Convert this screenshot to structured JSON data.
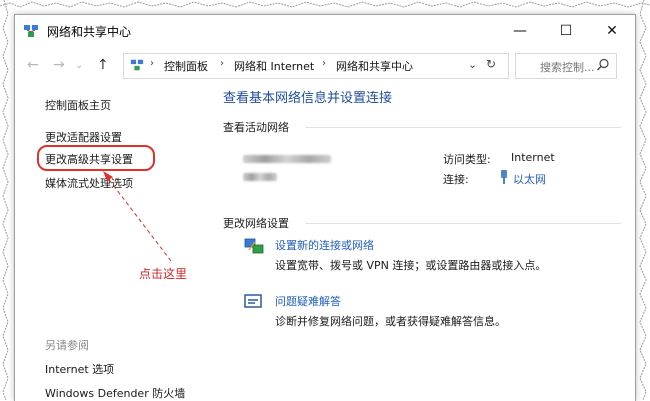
{
  "window": {
    "title": "网络和共享中心",
    "controls": {
      "minimize": "—",
      "maximize": "☐",
      "close": "✕"
    }
  },
  "address_bar": {
    "crumbs": [
      "控制面板",
      "网络和 Internet",
      "网络和共享中心"
    ],
    "search_placeholder": "搜索控制..."
  },
  "sidebar": {
    "home": "控制面板主页",
    "links": [
      "更改适配器设置",
      "更改高级共享设置",
      "媒体流式处理选项"
    ],
    "see_also_header": "另请参阅",
    "see_also": [
      "Internet 选项",
      "Windows Defender 防火墙"
    ]
  },
  "annotation": {
    "text": "点击这里",
    "color": "#d02828"
  },
  "main": {
    "title": "查看基本网络信息并设置连接",
    "active_networks_header": "查看活动网络",
    "access_type_label": "访问类型:",
    "access_type_value": "Internet",
    "connection_label": "连接:",
    "connection_value": "以太网",
    "change_settings_header": "更改网络设置",
    "tasks": [
      {
        "icon": "network-setup-icon",
        "link": "设置新的连接或网络",
        "desc": "设置宽带、拨号或 VPN 连接；或设置路由器或接入点。"
      },
      {
        "icon": "troubleshoot-icon",
        "link": "问题疑难解答",
        "desc": "诊断并修复网络问题，或者获得疑难解答信息。"
      }
    ]
  },
  "colors": {
    "link": "#1f5fbf",
    "title": "#1f4e9c",
    "highlight": "#e0312a"
  }
}
